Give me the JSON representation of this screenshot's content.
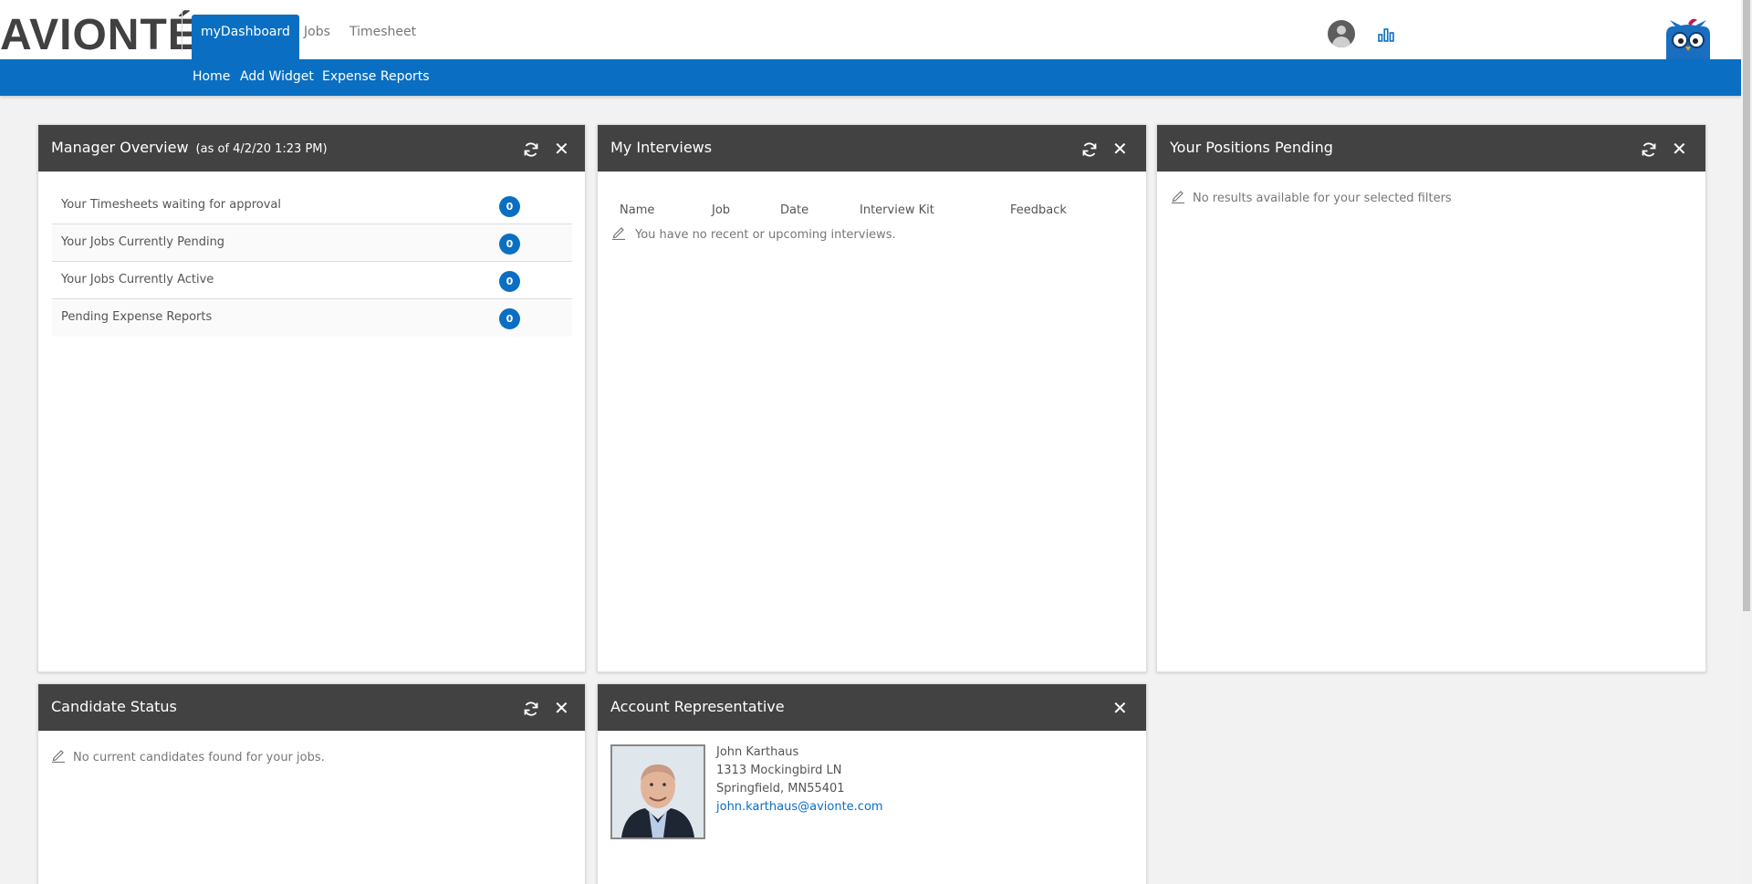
{
  "brand": {
    "logo_text": "AVIONTÉ"
  },
  "topnav": {
    "tabs": [
      {
        "label": "myDashboard",
        "active": true
      },
      {
        "label": "Jobs",
        "active": false
      },
      {
        "label": "Timesheet",
        "active": false
      }
    ]
  },
  "subnav": {
    "links": [
      "Home",
      "Add Widget",
      "Expense Reports"
    ]
  },
  "colors": {
    "accent": "#0a6fc2",
    "widget_header": "#424242"
  },
  "icons": {
    "refresh": "refresh-icon",
    "close": "close-icon",
    "pencil": "pencil-icon",
    "stats": "bar-chart-icon",
    "user": "user-avatar-icon",
    "mascot": "owl-mascot-icon"
  },
  "widgets": {
    "manager_overview": {
      "title": "Manager Overview",
      "subtitle": "(as of 4/2/20 1:23 PM)",
      "close_symbol": "✕",
      "rows": [
        {
          "label": "Your Timesheets waiting for approval",
          "count": "0"
        },
        {
          "label": "Your Jobs Currently Pending",
          "count": "0"
        },
        {
          "label": "Your Jobs Currently Active",
          "count": "0"
        },
        {
          "label": "Pending Expense Reports",
          "count": "0"
        }
      ]
    },
    "interviews": {
      "title": "My Interviews",
      "close_symbol": "✕",
      "columns": [
        "Name",
        "Job",
        "Date",
        "Interview Kit",
        "Feedback"
      ],
      "empty_message": "You have no recent or upcoming interviews."
    },
    "positions_pending": {
      "title": "Your Positions Pending",
      "close_symbol": "✕",
      "empty_message": "No results available for your selected filters"
    },
    "candidate_status": {
      "title": "Candidate Status",
      "close_symbol": "✕",
      "empty_message": "No current candidates found for your jobs."
    },
    "account_rep": {
      "title": "Account Representative",
      "close_symbol": "✕",
      "name": "John Karthaus",
      "address1": "1313 Mockingbird LN",
      "address2": "Springfield, MN55401",
      "email": "john.karthaus@avionte.com"
    }
  }
}
